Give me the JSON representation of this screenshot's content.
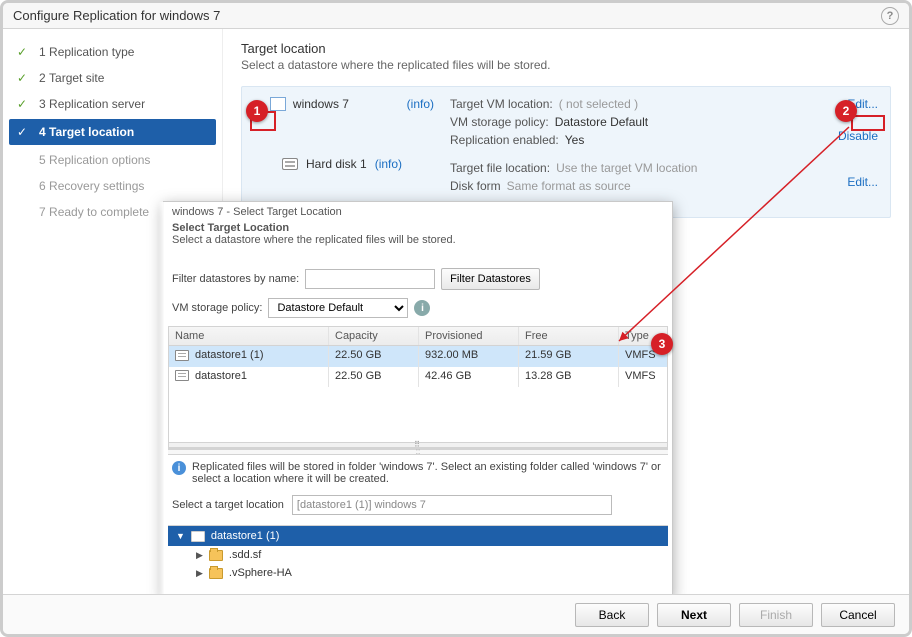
{
  "window": {
    "title": "Configure Replication for windows 7"
  },
  "steps": [
    {
      "n": "1",
      "label": "Replication type",
      "state": "done"
    },
    {
      "n": "2",
      "label": "Target site",
      "state": "done"
    },
    {
      "n": "3",
      "label": "Replication server",
      "state": "done"
    },
    {
      "n": "4",
      "label": "Target location",
      "state": "current"
    },
    {
      "n": "5",
      "label": "Replication options",
      "state": "pending"
    },
    {
      "n": "6",
      "label": "Recovery settings",
      "state": "pending"
    },
    {
      "n": "7",
      "label": "Ready to complete",
      "state": "pending"
    }
  ],
  "main": {
    "heading": "Target location",
    "sub": "Select a datastore where the replicated files will be stored."
  },
  "vm": {
    "name": "windows 7",
    "info": "(info)",
    "disk_label": "Hard disk 1",
    "disk_info": "(info)",
    "target_vm_loc_label": "Target VM location:",
    "target_vm_loc_value": "( not selected )",
    "policy_label": "VM storage policy:",
    "policy_value": "Datastore Default",
    "enabled_label": "Replication enabled:",
    "enabled_value": "Yes",
    "file_loc_label": "Target file location:",
    "file_loc_value": "Use the target VM location",
    "disk_format_label": "Disk form",
    "disk_format_value": "Same format as source",
    "edit": "Edit...",
    "disable": "Disable",
    "edit2": "Edit..."
  },
  "popup": {
    "crumb": "windows 7 - Select Target Location",
    "title": "Select Target Location",
    "sub": "Select a datastore where the replicated files will be stored.",
    "filter_label": "Filter datastores by name:",
    "filter_button": "Filter Datastores",
    "policy_label": "VM storage policy:",
    "policy_value": "Datastore Default",
    "columns": {
      "name": "Name",
      "capacity": "Capacity",
      "provisioned": "Provisioned",
      "free": "Free",
      "type": "Type"
    },
    "rows": [
      {
        "name": "datastore1 (1)",
        "capacity": "22.50 GB",
        "provisioned": "932.00 MB",
        "free": "21.59 GB",
        "type": "VMFS",
        "selected": true
      },
      {
        "name": "datastore1",
        "capacity": "22.50 GB",
        "provisioned": "42.46 GB",
        "free": "13.28 GB",
        "type": "VMFS",
        "selected": false
      }
    ],
    "note": "Replicated files will be stored in folder 'windows 7'. Select an existing folder called 'windows 7' or select a location where it will be created.",
    "target_label": "Select a target location",
    "target_value": "[datastore1 (1)] windows 7",
    "tree": {
      "root": "datastore1 (1)",
      "children": [
        ".sdd.sf",
        ".vSphere-HA"
      ]
    }
  },
  "footer": {
    "back": "Back",
    "next": "Next",
    "finish": "Finish",
    "cancel": "Cancel"
  },
  "callouts": {
    "c1": "1",
    "c2": "2",
    "c3": "3"
  }
}
